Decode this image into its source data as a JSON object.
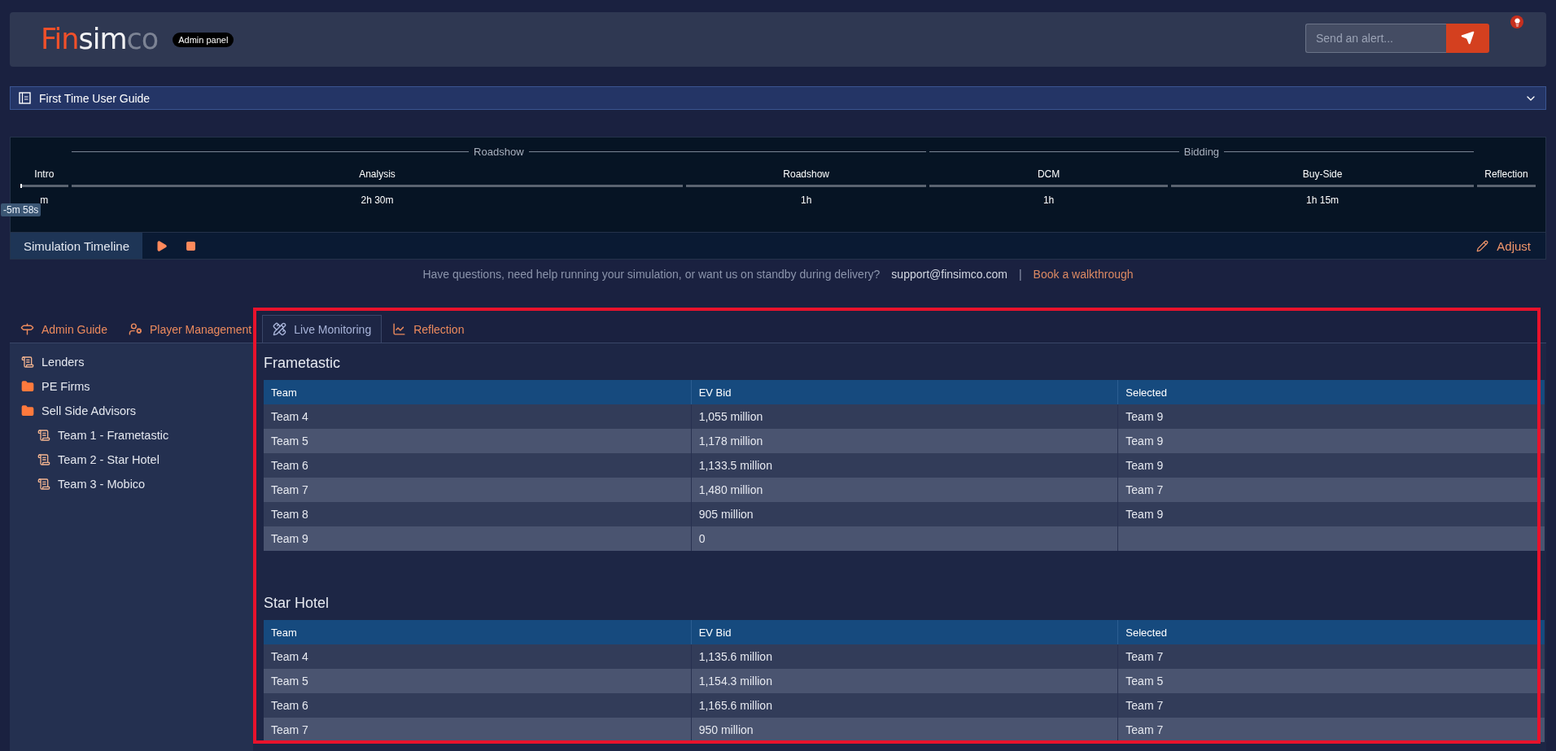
{
  "header": {
    "logo": [
      {
        "text": "Fin",
        "kind": "accent"
      },
      {
        "text": "sim",
        "kind": "plain"
      },
      {
        "text": "co",
        "kind": "muted"
      }
    ],
    "badge": "Admin panel",
    "alert": {
      "placeholder": "Send an alert..."
    }
  },
  "guide": {
    "title": "First Time User Guide",
    "expanded": false
  },
  "timeline": {
    "groups": [
      {
        "label": "Roadshow"
      },
      {
        "label": "Bidding"
      }
    ],
    "phases": [
      {
        "name": "Intro",
        "duration": "m"
      },
      {
        "name": "Analysis",
        "duration": "2h 30m"
      },
      {
        "name": "Roadshow",
        "duration": "1h"
      },
      {
        "name": "DCM",
        "duration": "1h"
      },
      {
        "name": "Buy-Side",
        "duration": "1h 15m"
      },
      {
        "name": "Reflection"
      }
    ],
    "clock": "-5m 58s",
    "label": "Simulation Timeline",
    "adjust": "Adjust"
  },
  "help": {
    "text": "Have questions, need help running your simulation, or want us on standby during delivery?",
    "email": "support@finsimco.com",
    "separator": "|",
    "link": "Book a walkthrough"
  },
  "tabs": [
    {
      "label": "Admin Guide",
      "selected": false
    },
    {
      "label": "Player Management",
      "selected": false
    },
    {
      "label": "Live Monitoring",
      "selected": true
    },
    {
      "label": "Reflection",
      "selected": false
    }
  ],
  "sidebar": {
    "items": [
      {
        "label": "Lenders",
        "kind": "document"
      },
      {
        "label": "PE Firms",
        "kind": "folder"
      },
      {
        "label": "Sell Side Advisors",
        "kind": "folder",
        "children": [
          {
            "label": "Team 1 - Frametastic",
            "kind": "document"
          },
          {
            "label": "Team 2 - Star Hotel",
            "kind": "document"
          },
          {
            "label": "Team 3 - Mobico",
            "kind": "document"
          }
        ]
      }
    ]
  },
  "sections": [
    {
      "title": "Frametastic",
      "columns": [
        "Team",
        "EV Bid",
        "Selected"
      ],
      "rows": [
        [
          "Team 4",
          "1,055 million",
          "Team 9"
        ],
        [
          "Team 5",
          "1,178 million",
          "Team 9"
        ],
        [
          "Team 6",
          "1,133.5 million",
          "Team 9"
        ],
        [
          "Team 7",
          "1,480 million",
          "Team 7"
        ],
        [
          "Team 8",
          "905 million",
          "Team 9"
        ],
        [
          "Team 9",
          "0",
          ""
        ]
      ]
    },
    {
      "title": "Star Hotel",
      "columns": [
        "Team",
        "EV Bid",
        "Selected"
      ],
      "rows": [
        [
          "Team 4",
          "1,135.6 million",
          "Team 7"
        ],
        [
          "Team 5",
          "1,154.3 million",
          "Team 5"
        ],
        [
          "Team 6",
          "1,165.6 million",
          "Team 7"
        ],
        [
          "Team 7",
          "950 million",
          "Team 7"
        ]
      ]
    }
  ]
}
